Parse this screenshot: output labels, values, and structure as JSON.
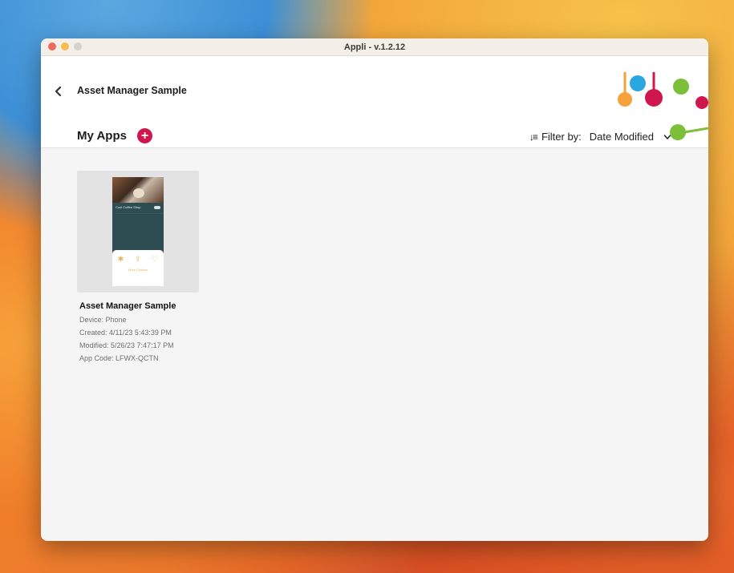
{
  "window": {
    "title": "Appli - v.1.2.12"
  },
  "header": {
    "app_title": "Asset Manager Sample",
    "back_icon": "chevron-left-icon",
    "section_title": "My Apps",
    "add_icon": "plus-circle-icon",
    "filter": {
      "label": "Filter by:",
      "value": "Date Modified",
      "sort_icon": "sort-icon",
      "chevron": "chevron-down-icon"
    }
  },
  "apps": [
    {
      "name": "Asset Manager Sample",
      "device": "Device: Phone",
      "created": "Created: 4/11/23 5:43:39 PM",
      "modified": "Modified: 5/26/23 7:47:17 PM",
      "code": "App Code: LFWX-QCTN",
      "preview": {
        "title": "Cool Coffee Shop",
        "more": "More Options"
      }
    }
  ],
  "colors": {
    "accent": "#d0174d",
    "logo_orange": "#f6a13a",
    "logo_blue": "#2aa6e0",
    "logo_red": "#d0174d",
    "logo_green": "#7cbf3a"
  }
}
